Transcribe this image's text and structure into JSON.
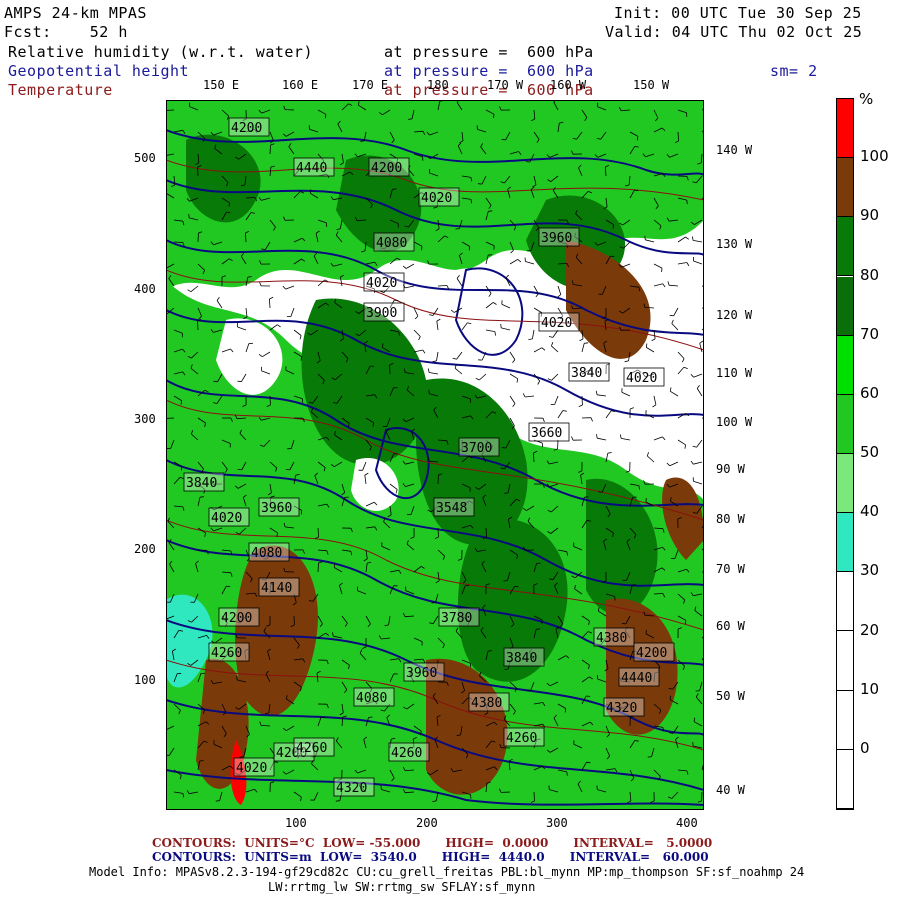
{
  "header": {
    "model": "AMPS 24-km MPAS",
    "forecast": "Fcst:    52 h",
    "init": "Init: 00 UTC Tue 30 Sep 25",
    "valid": "Valid: 04 UTC Thu 02 Oct 25",
    "var1": "Relative humidity (w.r.t. water)",
    "var2": "Geopotential height",
    "var3": "Temperature",
    "pressure1": "at pressure =  600 hPa",
    "pressure2": "at pressure =  600 hPa",
    "pressure3": "at pressure =  600 hPa",
    "smoothing": "sm= 2"
  },
  "colors": {
    "var1": "#000000",
    "var2": "#1a1a9a",
    "var3": "#8b1a1a",
    "height_contour": "#0a0a80",
    "temp_contour": "#8b1010"
  },
  "top_lon_labels": [
    "150 E",
    "160 E",
    "170 E",
    "180",
    "170 W",
    "160 W",
    "150 W"
  ],
  "right_lon_labels": [
    "140 W",
    "130 W",
    "120 W",
    "110 W",
    "100 W",
    "90 W",
    "80 W",
    "70 W",
    "60 W",
    "50 W",
    "40 W"
  ],
  "y_axis_labels": [
    "500",
    "400",
    "300",
    "200",
    "100"
  ],
  "x_axis_labels": [
    "100",
    "200",
    "300",
    "400"
  ],
  "colorbar": {
    "unit": "%",
    "labels": [
      "100",
      "90",
      "80",
      "70",
      "60",
      "50",
      "40",
      "30",
      "20",
      "10",
      "0"
    ],
    "colors": [
      "#ff0000",
      "#7a3a0a",
      "#087a08",
      "#0a6e0a",
      "#00e000",
      "#22c822",
      "#7ae87a",
      "#30e8c0",
      "#ffffff",
      "#ffffff",
      "#ffffff",
      "#ffffff"
    ]
  },
  "height_labels": [
    "4200",
    "4440",
    "4200",
    "4020",
    "4080",
    "4020",
    "3960",
    "3900",
    "4020",
    "3840",
    "4020",
    "3660",
    "3700",
    "3548",
    "3840",
    "3960",
    "4020",
    "4080",
    "4140",
    "4200",
    "4260",
    "4380",
    "4320",
    "4260",
    "4200",
    "3780",
    "3840",
    "3960",
    "4080",
    "4260",
    "4440",
    "4380",
    "4260",
    "4320",
    "4020",
    "4200"
  ],
  "footer": {
    "line1_left": "CONTOURS:  UNITS=°C  LOW= -55.000      HIGH=  0.0000      INTERVAL=   5.0000",
    "line2_left": "CONTOURS:  UNITS=m  LOW=  3540.0      HIGH=  4440.0      INTERVAL=   60.000",
    "model_info": "Model Info: MPASv8.2.3-194-gf29cd82c CU:cu_grell_freitas PBL:bl_mynn MP:mp_thompson SF:sf_noahmp 24",
    "model_info2": "LW:rrtmg_lw SW:rrtmg_sw SFLAY:sf_mynn"
  }
}
